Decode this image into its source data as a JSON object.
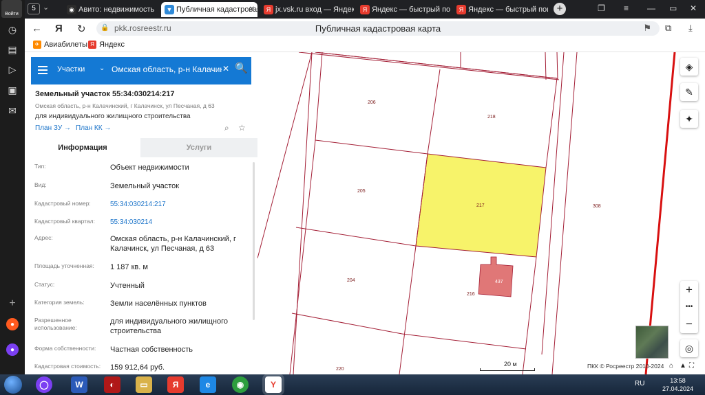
{
  "browser": {
    "side_panel": {
      "top_button_label": "Войти",
      "tab_counter": "5"
    },
    "tabs": [
      {
        "title": "Авито: недвижимость",
        "favicon_color": "#2b2b2b"
      },
      {
        "title": "Публичная кадастровая",
        "favicon_color": "#2f8ad8",
        "active": true
      },
      {
        "title": "jx.vsk.ru вход — Яндекс",
        "favicon_color": "#e63b2e"
      },
      {
        "title": "Яндекс — быстрый пои",
        "favicon_color": "#e63b2e"
      },
      {
        "title": "Яндекс — быстрый пои",
        "favicon_color": "#e63b2e"
      }
    ],
    "address": {
      "url": "pkk.rosreestr.ru",
      "page_title": "Публичная кадастровая карта"
    },
    "bookmarks": [
      {
        "label": "Авиабилеты",
        "icon_color": "#ff8a00"
      },
      {
        "label": "Яндекс",
        "icon_color": "#e63b2e"
      }
    ]
  },
  "search": {
    "type": "Участки",
    "query": "Омская область, р-н Калачин"
  },
  "parcel": {
    "title": "Земельный участок 55:34:030214:217",
    "address_line": "Омская область, р-н Калачинский, г Калачинск, ул Песчаная, д 63",
    "use": "для индивидуального жилищного строительства",
    "plan_zu": "План ЗУ →",
    "plan_kk": "План КК →"
  },
  "tabs_panel": {
    "info": "Информация",
    "services": "Услуги"
  },
  "details": [
    {
      "label": "Тип:",
      "value": "Объект недвижимости"
    },
    {
      "label": "Вид:",
      "value": "Земельный участок"
    },
    {
      "label": "Кадастровый номер:",
      "value": "55:34:030214:217",
      "link": true
    },
    {
      "label": "Кадастровый квартал:",
      "value": "55:34:030214",
      "link": true
    },
    {
      "label": "Адрес:",
      "value": "Омская область, р-н Калачинский, г Калачинск, ул Песчаная, д 63"
    },
    {
      "label": "Площадь уточненная:",
      "value": "1 187 кв. м"
    },
    {
      "label": "Статус:",
      "value": "Учтенный"
    },
    {
      "label": "Категория земель:",
      "value": "Земли населённых пунктов"
    },
    {
      "label": "Разрешенное использование:",
      "value": "для индивидуального жилищного строительства"
    },
    {
      "label": "Форма собственности:",
      "value": "Частная собственность"
    },
    {
      "label": "Кадастровая стоимость:",
      "value": "159 912,64 руб."
    }
  ],
  "map": {
    "parcel_labels": [
      "206",
      "218",
      "205",
      "217",
      "308",
      "204",
      "437",
      "216",
      "220"
    ],
    "highlight_color": "#f7f36a",
    "building_color": "#e07777",
    "boundary_color": "#a31e35",
    "scale": "20 м",
    "copyright": "ПКК © Росреестр 2010-2024"
  },
  "taskbar": {
    "language": "RU",
    "time": "13:58",
    "date": "27.04.2024"
  }
}
